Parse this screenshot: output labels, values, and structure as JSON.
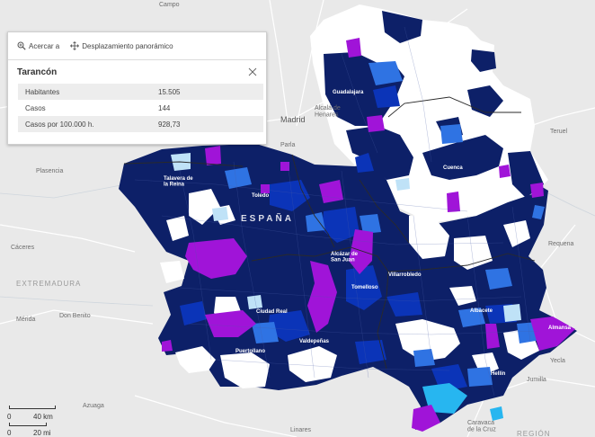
{
  "map": {
    "places": {
      "campo": "Campo",
      "madrid": "Madrid",
      "alcala": "Alcalá de\nHenares",
      "parla": "Parla",
      "teruel": "Teruel",
      "plasencia": "Plasencia",
      "caceres": "Cáceres",
      "merida": "Mérida",
      "don_benito": "Don Benito",
      "requena": "Requena",
      "yecla": "Yecla",
      "jumilla": "Jumilla",
      "azuaga": "Azuaga",
      "linares": "Linares",
      "caravaca": "Caravaca\nde la Cruz",
      "extremadura": "EXTREMADURA",
      "region": "REGIÓN",
      "espana": "ESPAÑA"
    },
    "cities": {
      "guadalajara": "Guadalajara",
      "cuenca": "Cuenca",
      "talavera": "Talavera de\nla Reina",
      "toledo": "Toledo",
      "alcazar": "Alcázar de\nSan Juan",
      "tomelloso": "Tomelloso",
      "villarrobledo": "Villarrobledo",
      "ciudad_real": "Ciudad Real",
      "puertollano": "Puertollano",
      "valdepenas": "Valdepeñas",
      "albacete": "Albacete",
      "almansa": "Almansa",
      "hellin": "Hellín"
    },
    "colors": {
      "background": "#e9e9e9",
      "dark_navy": "#0d2068",
      "royal_blue": "#0b34b8",
      "medium_blue": "#2f73e3",
      "light_blue": "#27b6f0",
      "pale_blue": "#bfe2f7",
      "purple": "#a014d8",
      "white": "#ffffff"
    }
  },
  "popup": {
    "actions": {
      "zoom_label": "Acercar a",
      "pan_label": "Desplazamiento panorámico"
    },
    "title": "Tarancón",
    "rows": [
      {
        "label": "Habitantes",
        "value": "15.505"
      },
      {
        "label": "Casos",
        "value": "144"
      },
      {
        "label": "Casos por 100.000 h.",
        "value": "928,73"
      }
    ]
  },
  "scalebar": {
    "km_left": "0",
    "km_right": "40 km",
    "mi_left": "0",
    "mi_right": "20 mi"
  }
}
